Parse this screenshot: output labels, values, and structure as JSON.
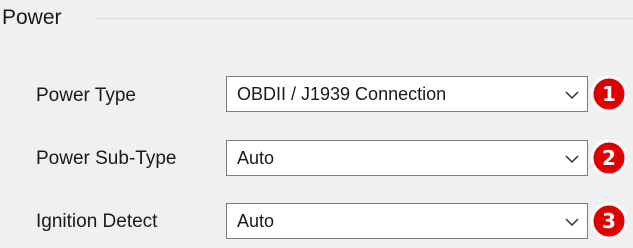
{
  "group": {
    "title": "Power"
  },
  "fields": [
    {
      "label": "Power Type",
      "value": "OBDII / J1939 Connection",
      "badge": "1"
    },
    {
      "label": "Power Sub-Type",
      "value": "Auto",
      "badge": "2"
    },
    {
      "label": "Ignition Detect",
      "value": "Auto",
      "badge": "3"
    }
  ],
  "icons": {
    "dropdown": "chevron-down-icon"
  },
  "colors": {
    "badge_fill": "#e00000",
    "badge_ring": "#ffffff",
    "combo_border": "#7a7a7a",
    "panel_bg": "#f0f0f0"
  }
}
